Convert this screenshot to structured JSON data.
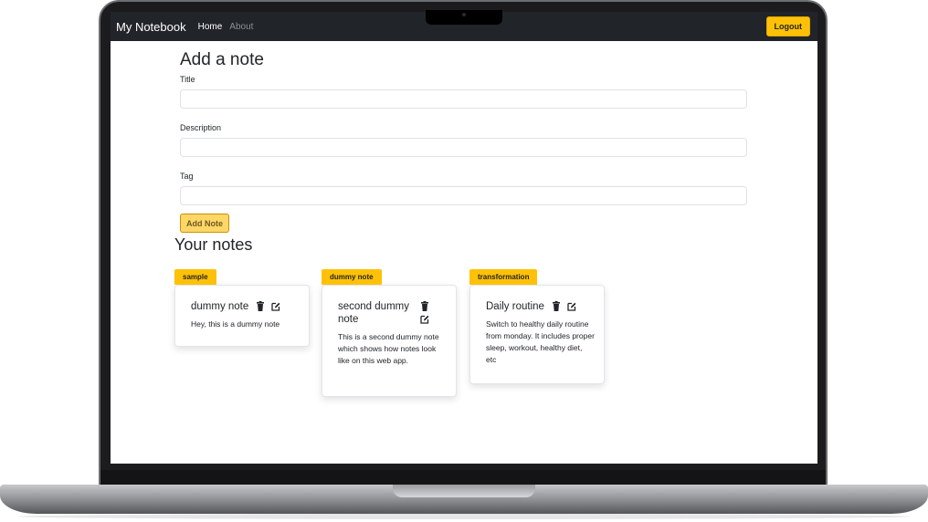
{
  "navbar": {
    "brand": "My Notebook",
    "links": [
      "Home",
      "About"
    ],
    "logout_label": "Logout"
  },
  "form": {
    "heading": "Add a note",
    "title_label": "Title",
    "description_label": "Description",
    "tag_label": "Tag",
    "title_value": "",
    "description_value": "",
    "tag_value": "",
    "submit_label": "Add Note"
  },
  "notes": {
    "heading": "Your notes",
    "items": [
      {
        "tag": "sample",
        "title": "dummy note",
        "description": "Hey, this is a dummy note"
      },
      {
        "tag": "dummy note",
        "title": "second dummy note",
        "description": "This is a second dummy note which shows how notes look like on this web app."
      },
      {
        "tag": "transformation",
        "title": "Daily routine",
        "description": "Switch to healthy daily routine from monday. It includes proper sleep, workout, healthy diet, etc"
      }
    ]
  },
  "icons": {
    "delete": "trash-icon",
    "edit": "edit-icon"
  },
  "colors": {
    "navbar": "#212529",
    "accent": "#ffc107"
  }
}
